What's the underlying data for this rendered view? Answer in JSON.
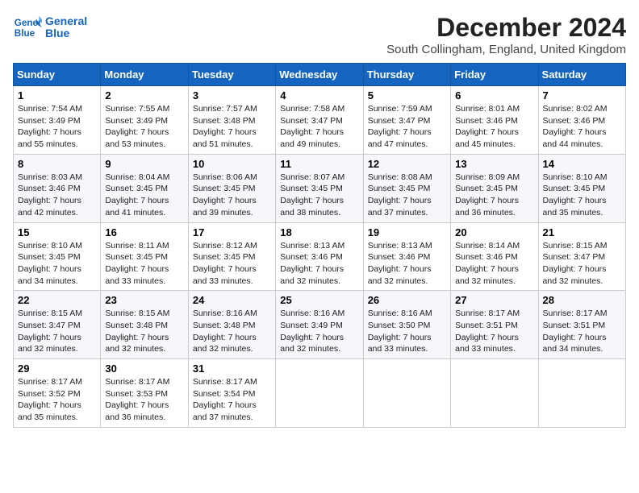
{
  "header": {
    "logo_line1": "General",
    "logo_line2": "Blue",
    "month_title": "December 2024",
    "subtitle": "South Collingham, England, United Kingdom"
  },
  "days_of_week": [
    "Sunday",
    "Monday",
    "Tuesday",
    "Wednesday",
    "Thursday",
    "Friday",
    "Saturday"
  ],
  "weeks": [
    [
      {
        "day": "1",
        "sunrise": "7:54 AM",
        "sunset": "3:49 PM",
        "daylight": "7 hours and 55 minutes."
      },
      {
        "day": "2",
        "sunrise": "7:55 AM",
        "sunset": "3:49 PM",
        "daylight": "7 hours and 53 minutes."
      },
      {
        "day": "3",
        "sunrise": "7:57 AM",
        "sunset": "3:48 PM",
        "daylight": "7 hours and 51 minutes."
      },
      {
        "day": "4",
        "sunrise": "7:58 AM",
        "sunset": "3:47 PM",
        "daylight": "7 hours and 49 minutes."
      },
      {
        "day": "5",
        "sunrise": "7:59 AM",
        "sunset": "3:47 PM",
        "daylight": "7 hours and 47 minutes."
      },
      {
        "day": "6",
        "sunrise": "8:01 AM",
        "sunset": "3:46 PM",
        "daylight": "7 hours and 45 minutes."
      },
      {
        "day": "7",
        "sunrise": "8:02 AM",
        "sunset": "3:46 PM",
        "daylight": "7 hours and 44 minutes."
      }
    ],
    [
      {
        "day": "8",
        "sunrise": "8:03 AM",
        "sunset": "3:46 PM",
        "daylight": "7 hours and 42 minutes."
      },
      {
        "day": "9",
        "sunrise": "8:04 AM",
        "sunset": "3:45 PM",
        "daylight": "7 hours and 41 minutes."
      },
      {
        "day": "10",
        "sunrise": "8:06 AM",
        "sunset": "3:45 PM",
        "daylight": "7 hours and 39 minutes."
      },
      {
        "day": "11",
        "sunrise": "8:07 AM",
        "sunset": "3:45 PM",
        "daylight": "7 hours and 38 minutes."
      },
      {
        "day": "12",
        "sunrise": "8:08 AM",
        "sunset": "3:45 PM",
        "daylight": "7 hours and 37 minutes."
      },
      {
        "day": "13",
        "sunrise": "8:09 AM",
        "sunset": "3:45 PM",
        "daylight": "7 hours and 36 minutes."
      },
      {
        "day": "14",
        "sunrise": "8:10 AM",
        "sunset": "3:45 PM",
        "daylight": "7 hours and 35 minutes."
      }
    ],
    [
      {
        "day": "15",
        "sunrise": "8:10 AM",
        "sunset": "3:45 PM",
        "daylight": "7 hours and 34 minutes."
      },
      {
        "day": "16",
        "sunrise": "8:11 AM",
        "sunset": "3:45 PM",
        "daylight": "7 hours and 33 minutes."
      },
      {
        "day": "17",
        "sunrise": "8:12 AM",
        "sunset": "3:45 PM",
        "daylight": "7 hours and 33 minutes."
      },
      {
        "day": "18",
        "sunrise": "8:13 AM",
        "sunset": "3:46 PM",
        "daylight": "7 hours and 32 minutes."
      },
      {
        "day": "19",
        "sunrise": "8:13 AM",
        "sunset": "3:46 PM",
        "daylight": "7 hours and 32 minutes."
      },
      {
        "day": "20",
        "sunrise": "8:14 AM",
        "sunset": "3:46 PM",
        "daylight": "7 hours and 32 minutes."
      },
      {
        "day": "21",
        "sunrise": "8:15 AM",
        "sunset": "3:47 PM",
        "daylight": "7 hours and 32 minutes."
      }
    ],
    [
      {
        "day": "22",
        "sunrise": "8:15 AM",
        "sunset": "3:47 PM",
        "daylight": "7 hours and 32 minutes."
      },
      {
        "day": "23",
        "sunrise": "8:15 AM",
        "sunset": "3:48 PM",
        "daylight": "7 hours and 32 minutes."
      },
      {
        "day": "24",
        "sunrise": "8:16 AM",
        "sunset": "3:48 PM",
        "daylight": "7 hours and 32 minutes."
      },
      {
        "day": "25",
        "sunrise": "8:16 AM",
        "sunset": "3:49 PM",
        "daylight": "7 hours and 32 minutes."
      },
      {
        "day": "26",
        "sunrise": "8:16 AM",
        "sunset": "3:50 PM",
        "daylight": "7 hours and 33 minutes."
      },
      {
        "day": "27",
        "sunrise": "8:17 AM",
        "sunset": "3:51 PM",
        "daylight": "7 hours and 33 minutes."
      },
      {
        "day": "28",
        "sunrise": "8:17 AM",
        "sunset": "3:51 PM",
        "daylight": "7 hours and 34 minutes."
      }
    ],
    [
      {
        "day": "29",
        "sunrise": "8:17 AM",
        "sunset": "3:52 PM",
        "daylight": "7 hours and 35 minutes."
      },
      {
        "day": "30",
        "sunrise": "8:17 AM",
        "sunset": "3:53 PM",
        "daylight": "7 hours and 36 minutes."
      },
      {
        "day": "31",
        "sunrise": "8:17 AM",
        "sunset": "3:54 PM",
        "daylight": "7 hours and 37 minutes."
      },
      null,
      null,
      null,
      null
    ]
  ]
}
